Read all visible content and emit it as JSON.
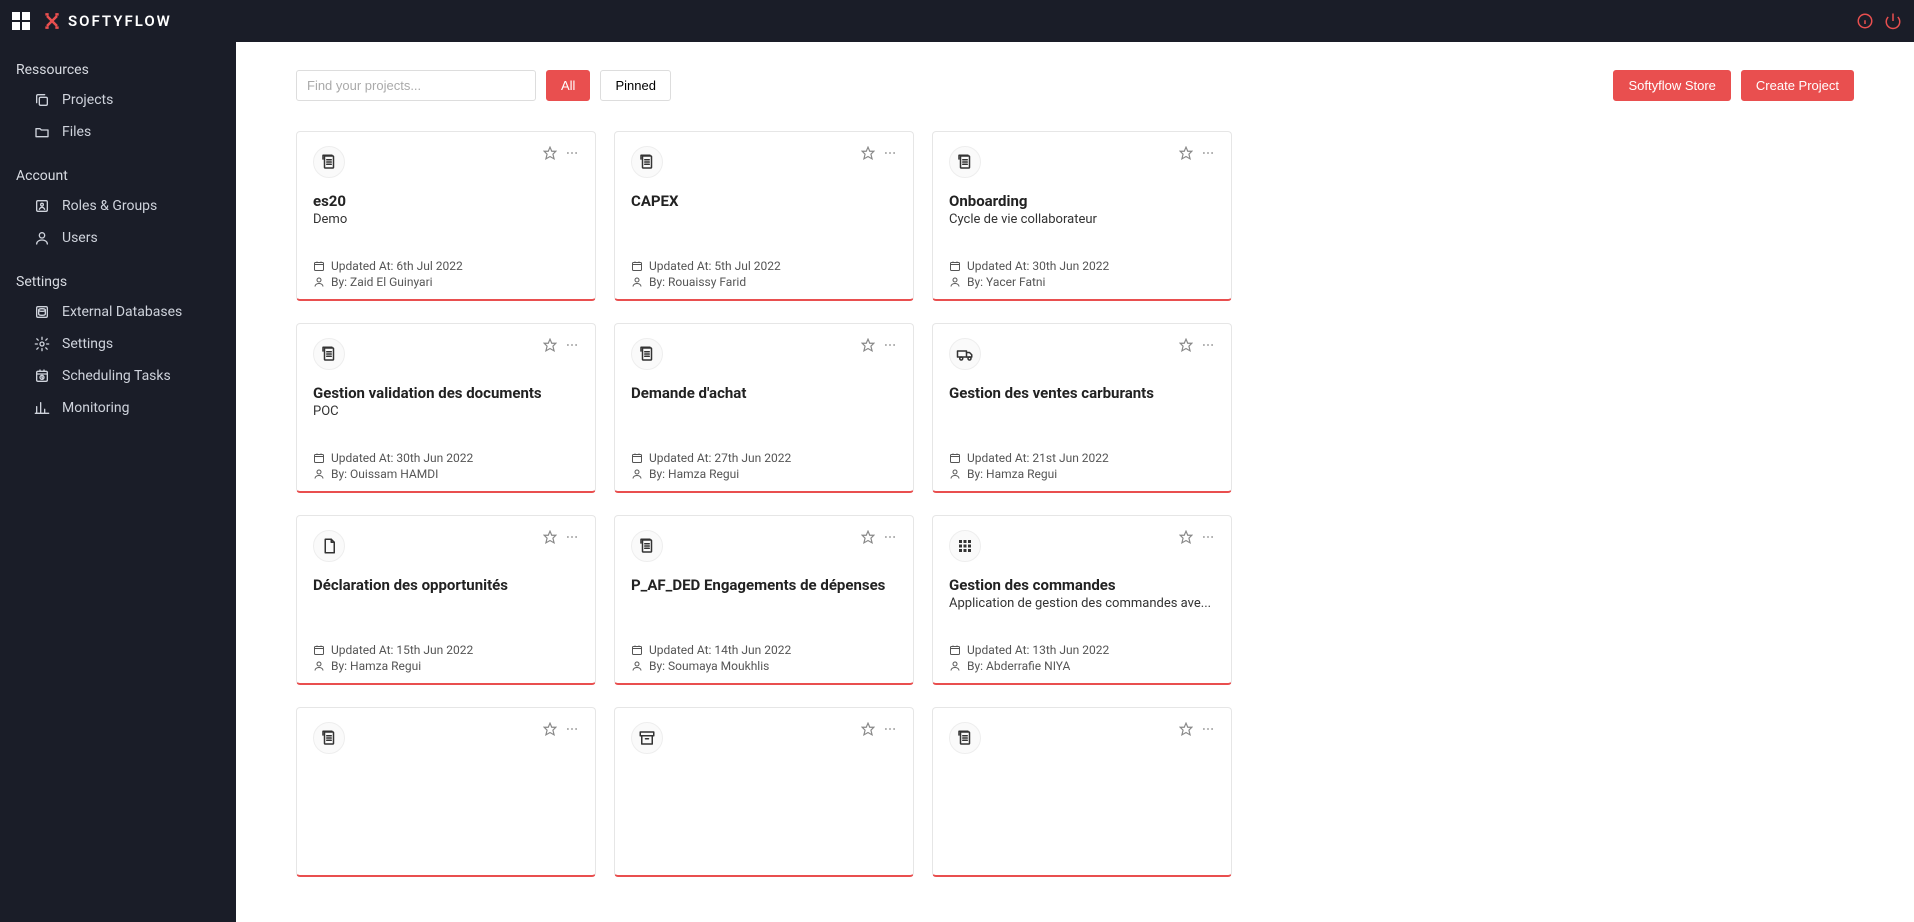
{
  "brand": {
    "name": "SOFTYFLOW"
  },
  "sidebar": {
    "sections": [
      {
        "title": "Ressources",
        "items": [
          {
            "label": "Projects",
            "icon": "copy-icon"
          },
          {
            "label": "Files",
            "icon": "folder-icon"
          }
        ]
      },
      {
        "title": "Account",
        "items": [
          {
            "label": "Roles & Groups",
            "icon": "roles-icon"
          },
          {
            "label": "Users",
            "icon": "user-icon"
          }
        ]
      },
      {
        "title": "Settings",
        "items": [
          {
            "label": "External Databases",
            "icon": "database-icon"
          },
          {
            "label": "Settings",
            "icon": "gear-icon"
          },
          {
            "label": "Scheduling Tasks",
            "icon": "schedule-icon"
          },
          {
            "label": "Monitoring",
            "icon": "chart-icon"
          }
        ]
      }
    ]
  },
  "toolbar": {
    "search_placeholder": "Find your projects...",
    "filter_all": "All",
    "filter_pinned": "Pinned",
    "store_label": "Softyflow Store",
    "create_label": "Create Project"
  },
  "meta_labels": {
    "updated_prefix": "Updated At: ",
    "by_prefix": "By: "
  },
  "projects": [
    {
      "title": "es20",
      "desc": "Demo",
      "updated": "6th Jul 2022",
      "by": "Zaid El Guinyari",
      "icon": "doc-icon"
    },
    {
      "title": "CAPEX",
      "desc": "",
      "updated": "5th Jul 2022",
      "by": "Rouaissy Farid",
      "icon": "doc-icon"
    },
    {
      "title": "Onboarding",
      "desc": "Cycle de vie collaborateur",
      "updated": "30th Jun 2022",
      "by": "Yacer Fatni",
      "icon": "doc-icon"
    },
    {
      "title": "Gestion validation des documents",
      "desc": "POC",
      "updated": "30th Jun 2022",
      "by": "Ouissam HAMDI",
      "icon": "doc-icon"
    },
    {
      "title": "Demande d'achat",
      "desc": "",
      "updated": "27th Jun 2022",
      "by": "Hamza Regui",
      "icon": "doc-icon"
    },
    {
      "title": "Gestion des ventes carburants",
      "desc": "",
      "updated": "21st Jun 2022",
      "by": "Hamza Regui",
      "icon": "truck-icon"
    },
    {
      "title": "Déclaration des opportunités",
      "desc": "",
      "updated": "15th Jun 2022",
      "by": "Hamza Regui",
      "icon": "file-icon"
    },
    {
      "title": "P_AF_DED Engagements de dépenses",
      "desc": "",
      "updated": "14th Jun 2022",
      "by": "Soumaya Moukhlis",
      "icon": "doc-icon"
    },
    {
      "title": "Gestion des commandes",
      "desc": "Application de gestion des commandes ave...",
      "updated": "13th Jun 2022",
      "by": "Abderrafie NIYA",
      "icon": "grid-icon"
    },
    {
      "title": "",
      "desc": "",
      "updated": "",
      "by": "",
      "icon": "doc-icon"
    },
    {
      "title": "",
      "desc": "",
      "updated": "",
      "by": "",
      "icon": "archive-icon"
    },
    {
      "title": "",
      "desc": "",
      "updated": "",
      "by": "",
      "icon": "doc-icon"
    }
  ]
}
